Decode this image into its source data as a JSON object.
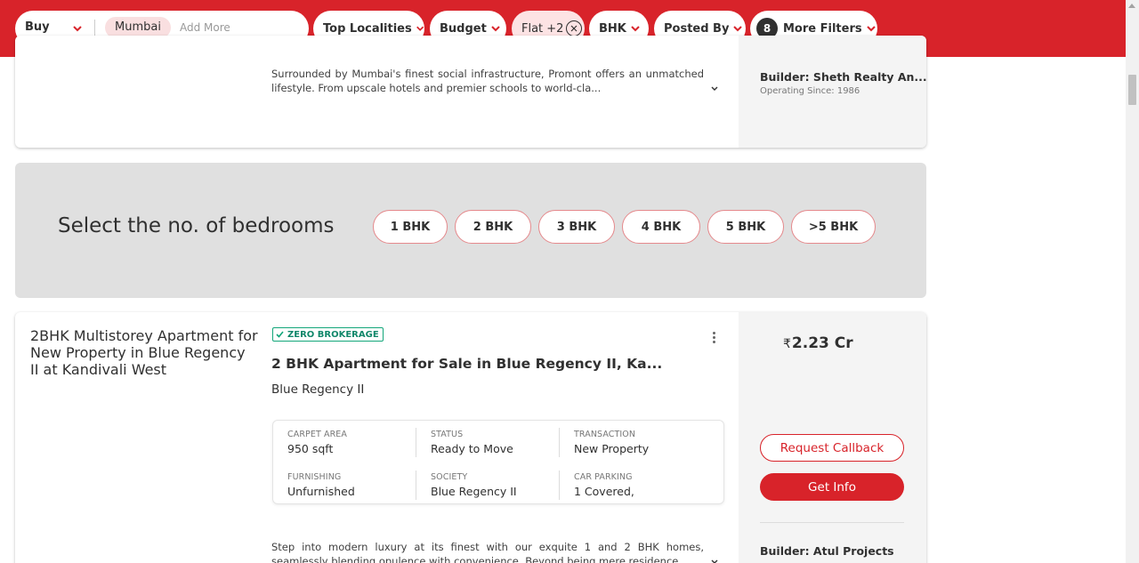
{
  "colors": {
    "brand": "#d8232a",
    "zero_brokerage": "#12a67a"
  },
  "search": {
    "mode": "Buy",
    "city": "Mumbai",
    "add_more_placeholder": "Add More"
  },
  "filters": {
    "top_localities": "Top Localities",
    "budget": "Budget",
    "property_type": "Flat +2",
    "bhk": "BHK",
    "posted_by": "Posted By",
    "more_filters_count": "8",
    "more_filters": "More Filters"
  },
  "listing_prev": {
    "description": "Surrounded by Mumbai's finest social infrastructure, Promont offers an unmatched lifestyle. From upscale hotels and premier schools to world-cla...",
    "builder": "Builder: Sheth Realty An...",
    "operating_since": "Operating Since: 1986"
  },
  "bhk_selector": {
    "title": "Select the no. of bedrooms",
    "options": [
      "1 BHK",
      "2 BHK",
      "3 BHK",
      "4 BHK",
      "5 BHK",
      ">5 BHK"
    ]
  },
  "listing": {
    "image_alt": "2BHK Multistorey Apartment for New Property in Blue Regency II at Kandivali West",
    "badge": "ZERO BROKERAGE",
    "title": "2 BHK Apartment for Sale in Blue Regency II, Ka...",
    "society": "Blue Regency II",
    "specs": [
      {
        "label": "CARPET AREA",
        "value": "950 sqft"
      },
      {
        "label": "STATUS",
        "value": "Ready to Move"
      },
      {
        "label": "TRANSACTION",
        "value": "New Property"
      },
      {
        "label": "FURNISHING",
        "value": "Unfurnished"
      },
      {
        "label": "SOCIETY",
        "value": "Blue Regency II"
      },
      {
        "label": "CAR PARKING",
        "value": "1 Covered,"
      }
    ],
    "description": "Step into modern luxury at its finest with our exquite 1 and 2 BHK homes, seamlessly blending opulence with convenience. Beyond being mere residence...",
    "currency": "₹",
    "price": "2.23 Cr",
    "request_callback": "Request Callback",
    "get_info": "Get Info",
    "builder": "Builder: Atul Projects"
  }
}
